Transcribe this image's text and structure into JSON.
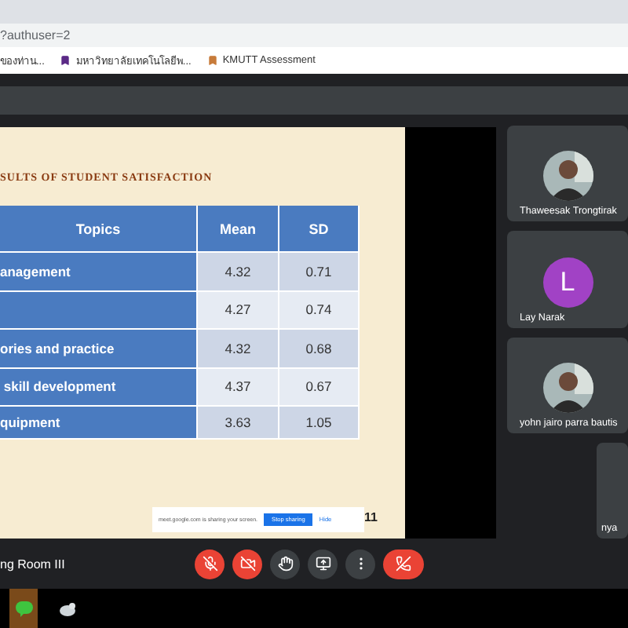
{
  "browser": {
    "url": "?authuser=2",
    "bookmarks": [
      {
        "label": "ของท่าน..."
      },
      {
        "label": "มหาวิทยาลัยเทคโนโลยีพ..."
      },
      {
        "label": "KMUTT Assessment"
      }
    ]
  },
  "slide": {
    "title": "SULTS OF STUDENT SATISFACTION",
    "columns": [
      "Topics",
      "Mean",
      "SD"
    ],
    "rows": [
      {
        "topic": "anagement",
        "mean": "4.32",
        "sd": "0.71"
      },
      {
        "mean": "4.27",
        "sd": "0.74"
      },
      {
        "topic": "ories and practice",
        "mean": "4.32",
        "sd": "0.68"
      },
      {
        "topic": " skill development",
        "mean": "4.37",
        "sd": "0.67"
      },
      {
        "topic": "quipment",
        "mean": "3.63",
        "sd": "1.05"
      }
    ],
    "page_number": "11"
  },
  "share_banner": {
    "message": "meet.google.com is sharing your screen.",
    "stop": "Stop sharing",
    "hide": "Hide"
  },
  "participants": [
    {
      "name": "Thaweesak Trongtirak"
    },
    {
      "name": "Lay Narak",
      "kind": "initial",
      "initial": "L",
      "color": "#a142c5"
    },
    {
      "name": "yohn jairo parra bautis"
    },
    {
      "name": "nya",
      "kind": "small"
    }
  ],
  "meeting_name": "ng Room III",
  "controls": [
    {
      "kind": "mic",
      "off": true
    },
    {
      "kind": "camera",
      "off": true
    },
    {
      "kind": "hand",
      "off": false
    },
    {
      "kind": "present",
      "off": false
    },
    {
      "kind": "more",
      "off": false
    },
    {
      "kind": "hangup",
      "off": true
    }
  ]
}
